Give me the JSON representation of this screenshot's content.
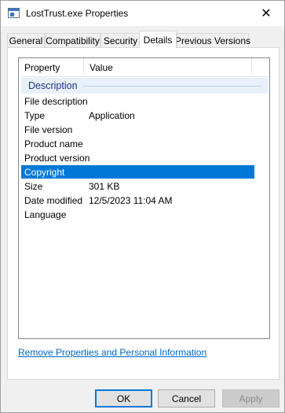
{
  "window": {
    "title": "LostTrust.exe Properties",
    "close_glyph": "✕"
  },
  "tabs": [
    {
      "label": "General",
      "active": false
    },
    {
      "label": "Compatibility",
      "active": false
    },
    {
      "label": "Security",
      "active": false
    },
    {
      "label": "Details",
      "active": true
    },
    {
      "label": "Previous Versions",
      "active": false
    }
  ],
  "details": {
    "columns": {
      "property": "Property",
      "value": "Value"
    },
    "group": "Description",
    "rows": [
      {
        "property": "File description",
        "value": ""
      },
      {
        "property": "Type",
        "value": "Application"
      },
      {
        "property": "File version",
        "value": ""
      },
      {
        "property": "Product name",
        "value": ""
      },
      {
        "property": "Product version",
        "value": ""
      },
      {
        "property": "Copyright",
        "value": "",
        "selected": true
      },
      {
        "property": "Size",
        "value": "301 KB"
      },
      {
        "property": "Date modified",
        "value": "12/5/2023 11:04 AM"
      },
      {
        "property": "Language",
        "value": ""
      }
    ]
  },
  "link": {
    "text": "Remove Properties and Personal Information"
  },
  "buttons": {
    "ok": "OK",
    "cancel": "Cancel",
    "apply": "Apply",
    "apply_enabled": false
  },
  "colors": {
    "selection": "#0078d7",
    "group_text": "#1e3287",
    "link": "#0066cc"
  }
}
